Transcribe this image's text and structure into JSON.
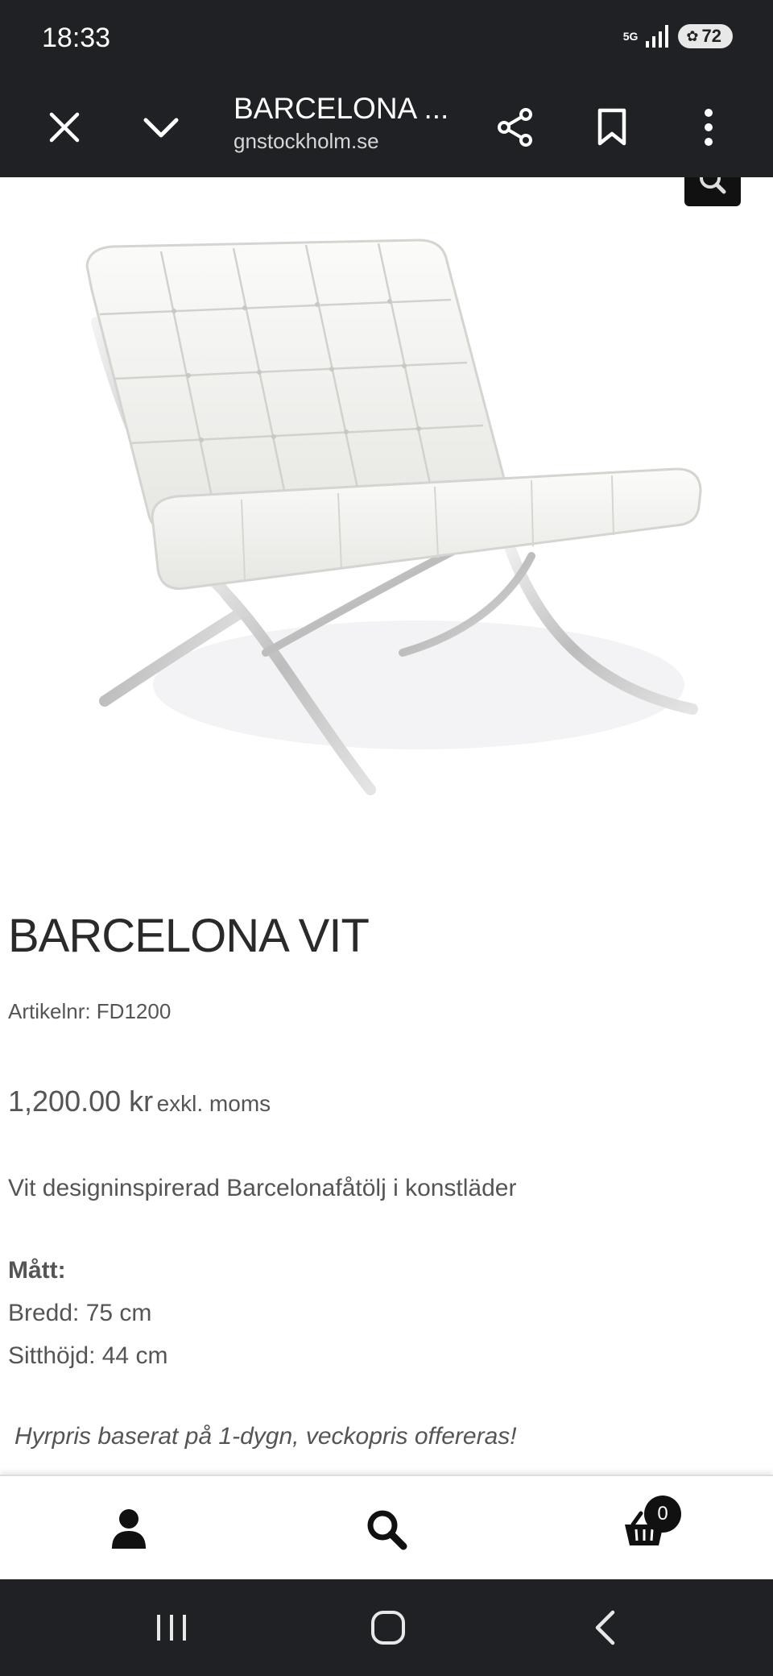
{
  "status_bar": {
    "time": "18:33",
    "network": "5G",
    "battery": "72"
  },
  "toolbar": {
    "title": "BARCELONA ...",
    "url": "gnstockholm.se",
    "icons": [
      "close-icon",
      "chevron-down-icon",
      "share-icon",
      "bookmark-icon",
      "more-vert-icon"
    ]
  },
  "product": {
    "name": "BARCELONA VIT",
    "article": "Artikelnr: FD1200",
    "price": "1,200.00 kr",
    "price_note": "exkl. moms",
    "description": "Vit designinspirerad Barcelonafåtölj i konstläder",
    "dimensions_label": "Mått:",
    "width": "Bredd: 75 cm",
    "seat_height": "Sitthöjd: 44 cm",
    "rental_note": "Hyrpris baserat på 1-dygn, veckopris offereras!"
  },
  "bottom_bar": {
    "cart_count": "0",
    "icons": [
      "user-icon",
      "search-icon",
      "basket-icon"
    ]
  },
  "nav_bar": {
    "icons": [
      "recents-icon",
      "home-icon",
      "back-icon"
    ]
  }
}
